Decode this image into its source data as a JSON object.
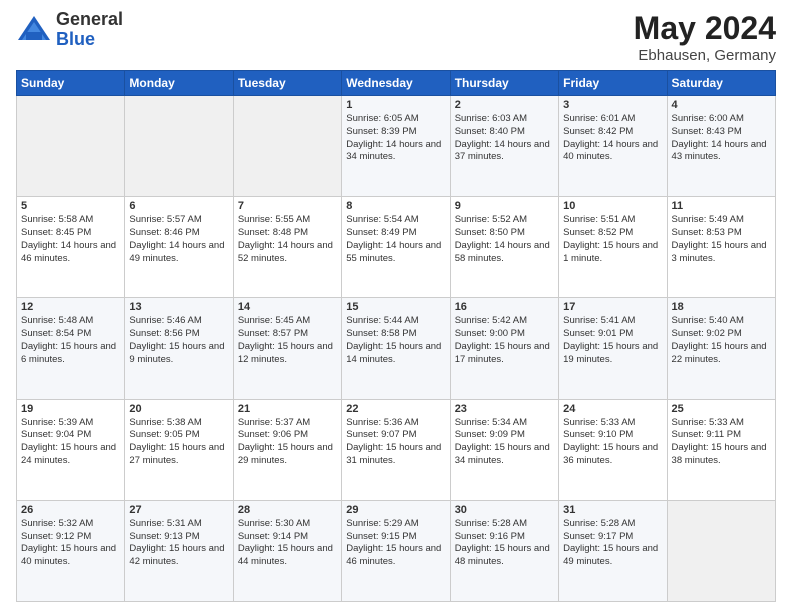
{
  "logo": {
    "general": "General",
    "blue": "Blue"
  },
  "title": "May 2024",
  "subtitle": "Ebhausen, Germany",
  "days": [
    "Sunday",
    "Monday",
    "Tuesday",
    "Wednesday",
    "Thursday",
    "Friday",
    "Saturday"
  ],
  "weeks": [
    [
      {
        "day": "",
        "content": ""
      },
      {
        "day": "",
        "content": ""
      },
      {
        "day": "",
        "content": ""
      },
      {
        "day": "1",
        "content": "Sunrise: 6:05 AM\nSunset: 8:39 PM\nDaylight: 14 hours\nand 34 minutes."
      },
      {
        "day": "2",
        "content": "Sunrise: 6:03 AM\nSunset: 8:40 PM\nDaylight: 14 hours\nand 37 minutes."
      },
      {
        "day": "3",
        "content": "Sunrise: 6:01 AM\nSunset: 8:42 PM\nDaylight: 14 hours\nand 40 minutes."
      },
      {
        "day": "4",
        "content": "Sunrise: 6:00 AM\nSunset: 8:43 PM\nDaylight: 14 hours\nand 43 minutes."
      }
    ],
    [
      {
        "day": "5",
        "content": "Sunrise: 5:58 AM\nSunset: 8:45 PM\nDaylight: 14 hours\nand 46 minutes."
      },
      {
        "day": "6",
        "content": "Sunrise: 5:57 AM\nSunset: 8:46 PM\nDaylight: 14 hours\nand 49 minutes."
      },
      {
        "day": "7",
        "content": "Sunrise: 5:55 AM\nSunset: 8:48 PM\nDaylight: 14 hours\nand 52 minutes."
      },
      {
        "day": "8",
        "content": "Sunrise: 5:54 AM\nSunset: 8:49 PM\nDaylight: 14 hours\nand 55 minutes."
      },
      {
        "day": "9",
        "content": "Sunrise: 5:52 AM\nSunset: 8:50 PM\nDaylight: 14 hours\nand 58 minutes."
      },
      {
        "day": "10",
        "content": "Sunrise: 5:51 AM\nSunset: 8:52 PM\nDaylight: 15 hours\nand 1 minute."
      },
      {
        "day": "11",
        "content": "Sunrise: 5:49 AM\nSunset: 8:53 PM\nDaylight: 15 hours\nand 3 minutes."
      }
    ],
    [
      {
        "day": "12",
        "content": "Sunrise: 5:48 AM\nSunset: 8:54 PM\nDaylight: 15 hours\nand 6 minutes."
      },
      {
        "day": "13",
        "content": "Sunrise: 5:46 AM\nSunset: 8:56 PM\nDaylight: 15 hours\nand 9 minutes."
      },
      {
        "day": "14",
        "content": "Sunrise: 5:45 AM\nSunset: 8:57 PM\nDaylight: 15 hours\nand 12 minutes."
      },
      {
        "day": "15",
        "content": "Sunrise: 5:44 AM\nSunset: 8:58 PM\nDaylight: 15 hours\nand 14 minutes."
      },
      {
        "day": "16",
        "content": "Sunrise: 5:42 AM\nSunset: 9:00 PM\nDaylight: 15 hours\nand 17 minutes."
      },
      {
        "day": "17",
        "content": "Sunrise: 5:41 AM\nSunset: 9:01 PM\nDaylight: 15 hours\nand 19 minutes."
      },
      {
        "day": "18",
        "content": "Sunrise: 5:40 AM\nSunset: 9:02 PM\nDaylight: 15 hours\nand 22 minutes."
      }
    ],
    [
      {
        "day": "19",
        "content": "Sunrise: 5:39 AM\nSunset: 9:04 PM\nDaylight: 15 hours\nand 24 minutes."
      },
      {
        "day": "20",
        "content": "Sunrise: 5:38 AM\nSunset: 9:05 PM\nDaylight: 15 hours\nand 27 minutes."
      },
      {
        "day": "21",
        "content": "Sunrise: 5:37 AM\nSunset: 9:06 PM\nDaylight: 15 hours\nand 29 minutes."
      },
      {
        "day": "22",
        "content": "Sunrise: 5:36 AM\nSunset: 9:07 PM\nDaylight: 15 hours\nand 31 minutes."
      },
      {
        "day": "23",
        "content": "Sunrise: 5:34 AM\nSunset: 9:09 PM\nDaylight: 15 hours\nand 34 minutes."
      },
      {
        "day": "24",
        "content": "Sunrise: 5:33 AM\nSunset: 9:10 PM\nDaylight: 15 hours\nand 36 minutes."
      },
      {
        "day": "25",
        "content": "Sunrise: 5:33 AM\nSunset: 9:11 PM\nDaylight: 15 hours\nand 38 minutes."
      }
    ],
    [
      {
        "day": "26",
        "content": "Sunrise: 5:32 AM\nSunset: 9:12 PM\nDaylight: 15 hours\nand 40 minutes."
      },
      {
        "day": "27",
        "content": "Sunrise: 5:31 AM\nSunset: 9:13 PM\nDaylight: 15 hours\nand 42 minutes."
      },
      {
        "day": "28",
        "content": "Sunrise: 5:30 AM\nSunset: 9:14 PM\nDaylight: 15 hours\nand 44 minutes."
      },
      {
        "day": "29",
        "content": "Sunrise: 5:29 AM\nSunset: 9:15 PM\nDaylight: 15 hours\nand 46 minutes."
      },
      {
        "day": "30",
        "content": "Sunrise: 5:28 AM\nSunset: 9:16 PM\nDaylight: 15 hours\nand 48 minutes."
      },
      {
        "day": "31",
        "content": "Sunrise: 5:28 AM\nSunset: 9:17 PM\nDaylight: 15 hours\nand 49 minutes."
      },
      {
        "day": "",
        "content": ""
      }
    ]
  ]
}
